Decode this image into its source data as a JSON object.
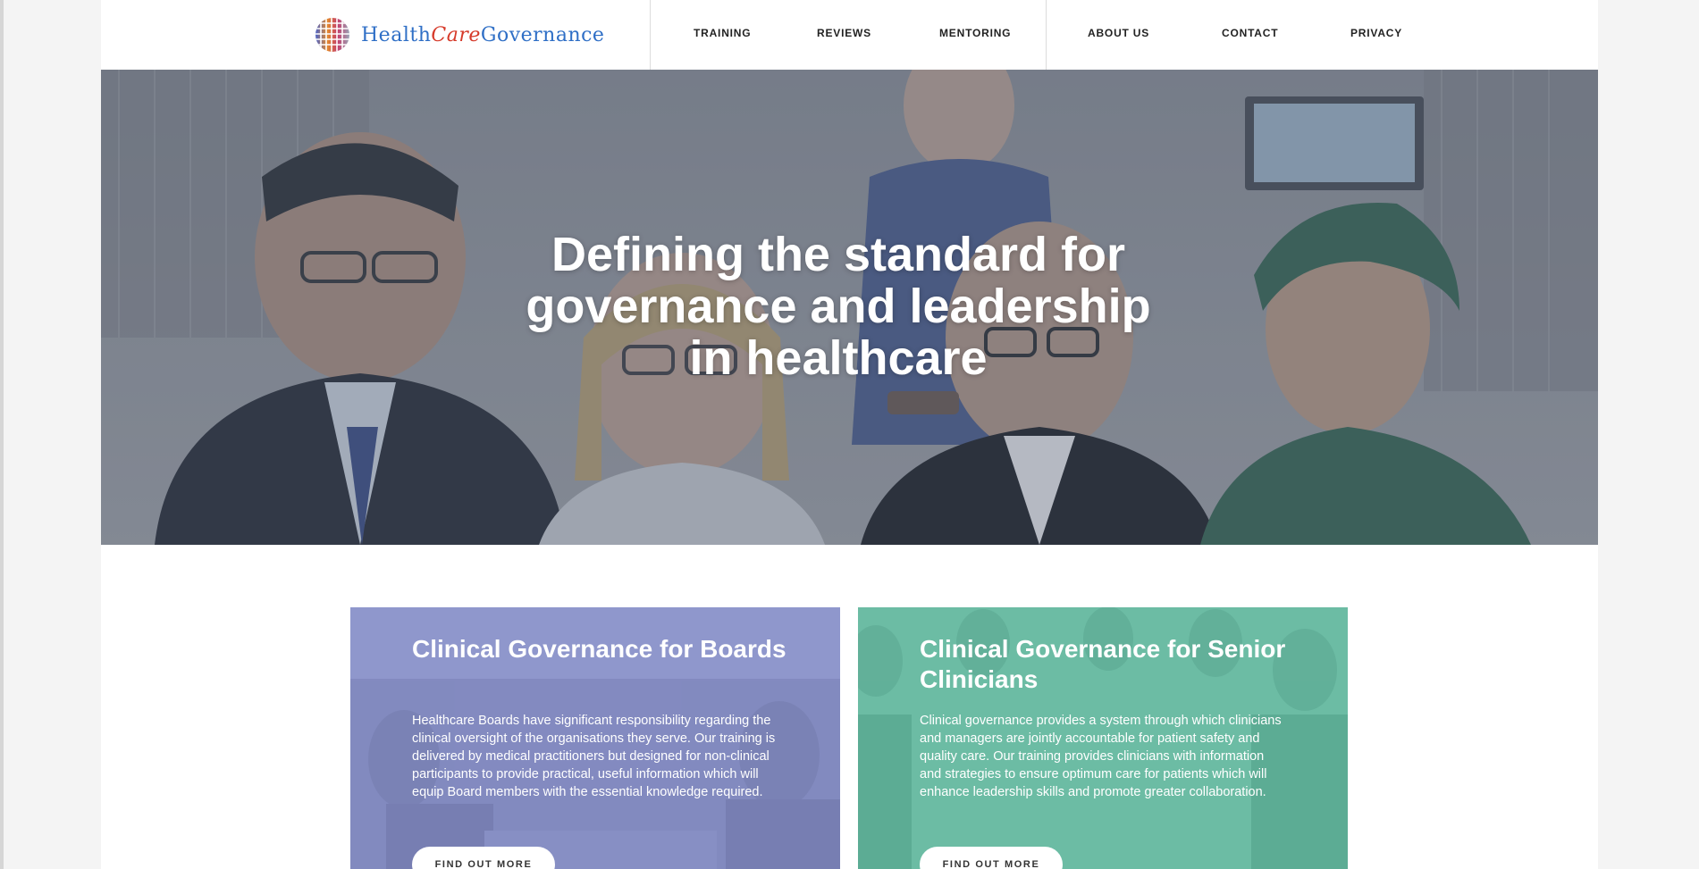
{
  "logo": {
    "part1": "Health",
    "part2": "Care",
    "part3": "Governance"
  },
  "nav": {
    "training": "TRAINING",
    "reviews": "REVIEWS",
    "mentoring": "MENTORING",
    "about": "ABOUT US",
    "contact": "CONTACT",
    "privacy": "PRIVACY"
  },
  "hero": {
    "title_line1": "Defining the standard for",
    "title_line2": "governance and leadership",
    "title_line3": "in healthcare"
  },
  "cards": [
    {
      "title": "Clinical Governance for Boards",
      "text": "Healthcare Boards have significant responsibility regarding the clinical oversight of the organisations they serve. Our training is delivered by medical practitioners but designed for non-clinical participants to provide practical, useful information which will equip Board members with the essential knowledge required.",
      "button": "FIND OUT MORE",
      "color": "#8f97cc"
    },
    {
      "title": "Clinical Governance for Senior Clinicians",
      "text": "Clinical governance provides a system through which clinicians and managers are jointly accountable for patient safety and quality care. Our training provides clinicians with information and strategies to ensure optimum care for patients which will enhance leadership skills and promote greater collaboration.",
      "button": "FIND OUT MORE",
      "color": "#6cbca4"
    }
  ]
}
